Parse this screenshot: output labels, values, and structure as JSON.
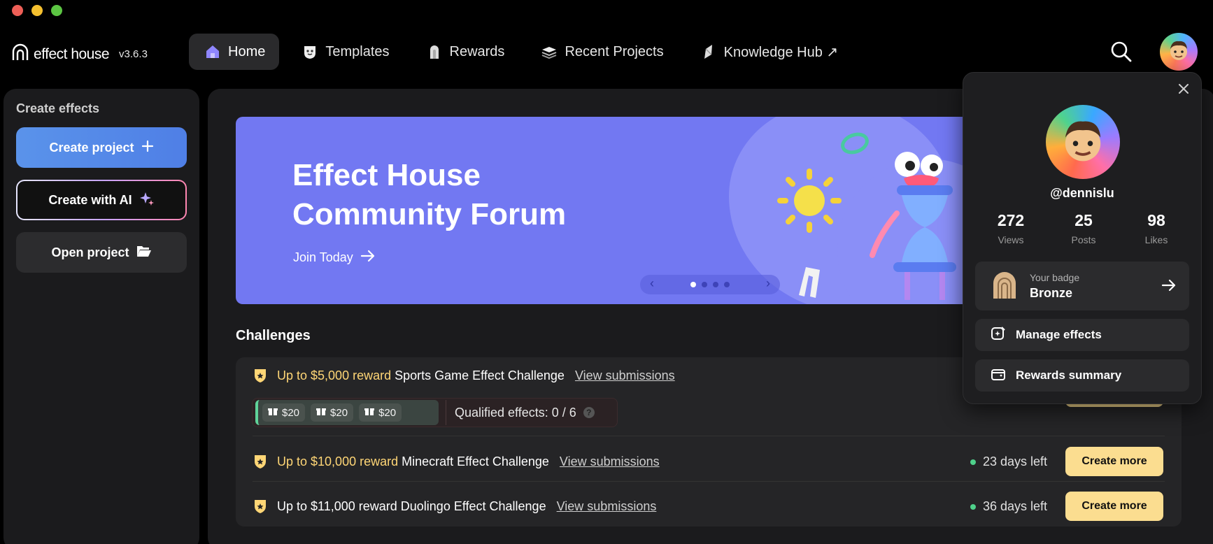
{
  "window": {
    "traffic_lights": [
      "#ee5f57",
      "#f5c02f",
      "#5cc543"
    ]
  },
  "brand": {
    "name": "effect house",
    "version": "v3.6.3"
  },
  "nav": {
    "items": [
      {
        "label": "Home",
        "icon": "home-icon",
        "active": true
      },
      {
        "label": "Templates",
        "icon": "templates-icon",
        "active": false
      },
      {
        "label": "Rewards",
        "icon": "rewards-icon",
        "active": false
      },
      {
        "label": "Recent Projects",
        "icon": "recent-projects-icon",
        "active": false
      },
      {
        "label": "Knowledge Hub ↗",
        "icon": "knowledge-hub-icon",
        "active": false
      }
    ]
  },
  "sidebar": {
    "title": "Create effects",
    "buttons": [
      {
        "label": "Create project",
        "icon": "plus-icon"
      },
      {
        "label": "Create with AI",
        "icon": "sparkle-icon"
      },
      {
        "label": "Open project",
        "icon": "folder-open-icon"
      }
    ]
  },
  "banner": {
    "title_line1": "Effect House",
    "title_line2": "Community Forum",
    "cta": "Join Today",
    "slides": 4,
    "active_slide": 1,
    "bg_color": "#7278f2"
  },
  "challenges": {
    "title": "Challenges",
    "items": [
      {
        "reward": "Up to $5,000 reward",
        "name": "Sports Game Effect Challenge",
        "link": "View submissions",
        "prizes": [
          "$20",
          "$20",
          "$20"
        ],
        "qualified": "Qualified effects: 0 / 6",
        "help": "?"
      },
      {
        "reward": "Up to $10,000 reward",
        "name": "Minecraft Effect Challenge",
        "link": "View submissions",
        "days_left": "23 days left",
        "action": "Create more"
      },
      {
        "reward": "",
        "name": "Up to $11,000 reward Duolingo Effect Challenge",
        "link": "View submissions",
        "days_left": "36 days left",
        "action": "Create more"
      }
    ]
  },
  "profile": {
    "username": "@dennislu",
    "stats": [
      {
        "value": "272",
        "label": "Views"
      },
      {
        "value": "25",
        "label": "Posts"
      },
      {
        "value": "98",
        "label": "Likes"
      }
    ],
    "badge": {
      "caption": "Your badge",
      "level": "Bronze"
    },
    "menu": [
      {
        "label": "Manage effects",
        "icon": "manage-effects-icon"
      },
      {
        "label": "Rewards summary",
        "icon": "wallet-icon"
      }
    ]
  },
  "colors": {
    "accent_blue": "#5a93ea",
    "reward_yellow": "#ffd676",
    "button_yellow": "#fbdd90",
    "status_green": "#4fd18b"
  }
}
